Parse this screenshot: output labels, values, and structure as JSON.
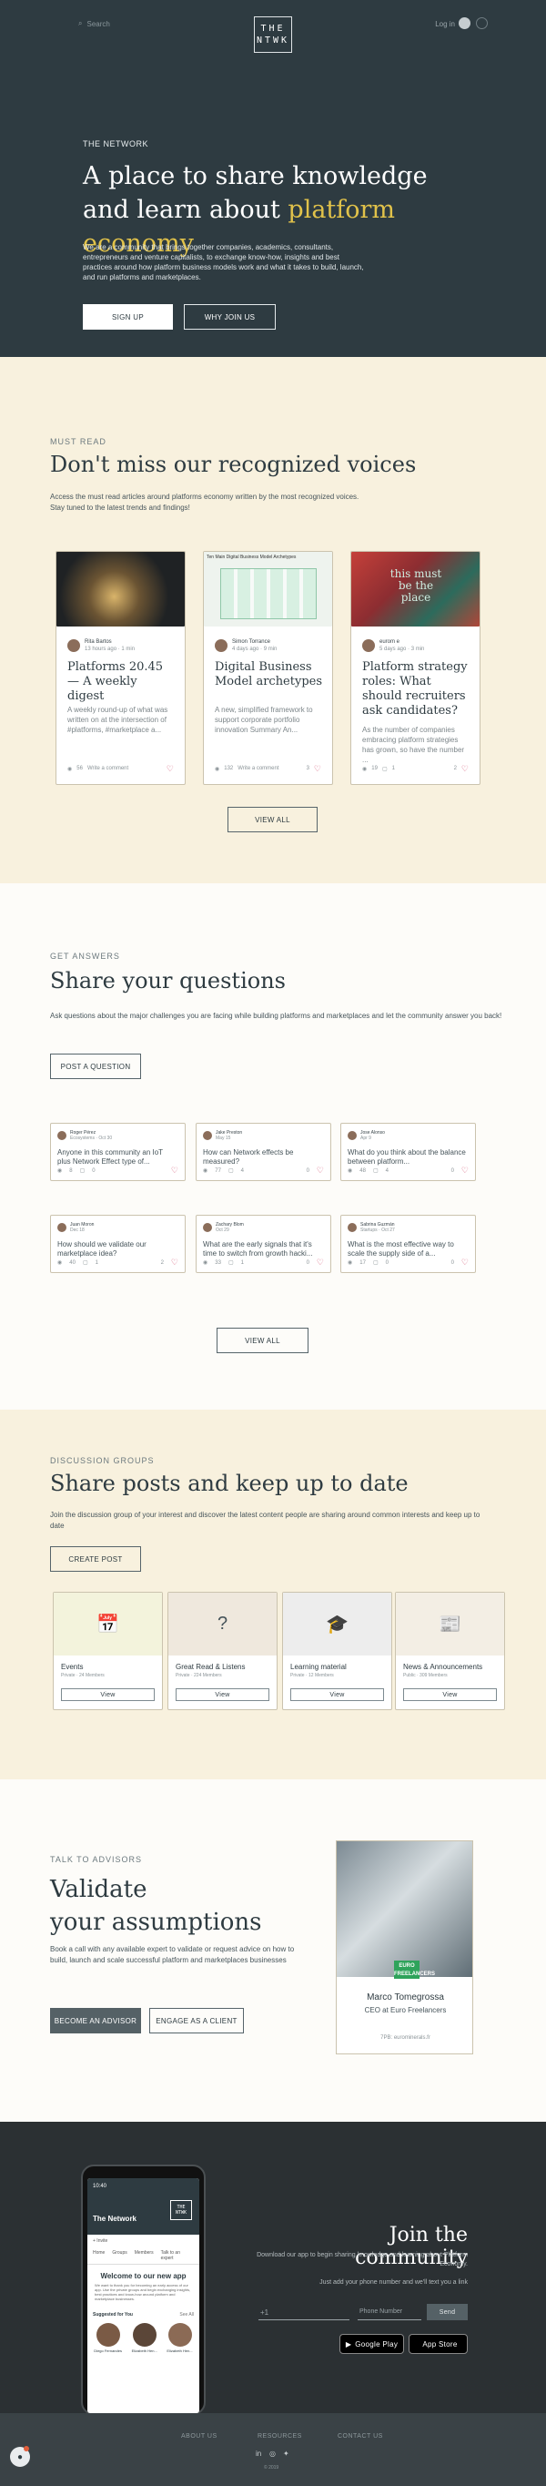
{
  "topbar": {
    "search_placeholder": "Search",
    "logo_line1": "THE",
    "logo_line2": "NTWK",
    "login": "Log in"
  },
  "hero": {
    "eyebrow": "THE NETWORK",
    "title_line1": "A place to share knowledge",
    "title_line2_prefix": "and learn about ",
    "title_highlight": "platform economy",
    "description": "We are a community that brings together companies, academics, consultants, entrepreneurs and venture capitalists, to exchange know-how, insights and best practices around how platform business models work and what it takes to build, launch, and run platforms and marketplaces.",
    "signup": "SIGN UP",
    "why": "WHY JOIN US",
    "colors": {
      "bg": "#2e3b41",
      "highlight": "#e1c24a"
    }
  },
  "must_read": {
    "eyebrow": "MUST READ",
    "title": "Don't miss our recognized voices",
    "description_line1": "Access the must read articles around platforms economy written by the most recognized voices.",
    "description_line2": "Stay tuned to the latest trends and findings!",
    "view_all": "VIEW ALL",
    "articles": [
      {
        "author": "Rita Bartos",
        "time": "13 hours ago · 1 min",
        "title": "Platforms 20.45 — A weekly digest",
        "excerpt": "A weekly round-up of what was written on at the intersection of #platforms, #marketplace a...",
        "views": "56",
        "comment_label": "Write a comment",
        "likes": ""
      },
      {
        "author": "Simon Torrance",
        "time": "4 days ago · 9 min",
        "title": "Digital Business Model archetypes",
        "excerpt": "A new, simplified framework to support corporate portfolio innovation Summary An...",
        "image_text": "Ten Main Digital Business Model Archetypes",
        "views": "132",
        "comment_label": "Write a comment",
        "likes": "3"
      },
      {
        "author": "eurom e",
        "time": "5 days ago · 3 min",
        "title": "Platform strategy roles: What should recruiters ask candidates?",
        "excerpt": "As the number of companies embracing platform strategies has grown, so have the number ...",
        "image_text": "this must be the place",
        "views": "19",
        "comments": "1",
        "likes": "2"
      }
    ]
  },
  "questions": {
    "eyebrow": "GET ANSWERS",
    "title": "Share your questions",
    "description": "Ask questions about the major challenges you are facing while building platforms and marketplaces and let the community answer you back!",
    "post_button": "POST A QUESTION",
    "view_all": "VIEW ALL",
    "items": [
      {
        "name": "Roger Pérez",
        "time": "Ecosystems · Oct 30",
        "question": "Anyone in this community an IoT plus Network Effect type of...",
        "views": "8",
        "answers": "0",
        "likes": ""
      },
      {
        "name": "Jake Preston",
        "time": "May 15",
        "question": "How can Network effects be measured?",
        "views": "77",
        "answers": "4",
        "likes": "0"
      },
      {
        "name": "Jose Alonso",
        "time": "Apr 9",
        "question": "What do you think about the balance between platform...",
        "views": "48",
        "answers": "4",
        "likes": "0"
      },
      {
        "name": "Juan Moron",
        "time": "Dec 18",
        "question": "How should we validate our marketplace idea?",
        "views": "40",
        "answers": "1",
        "likes": "2"
      },
      {
        "name": "Zachary Blom",
        "time": "Oct 29",
        "question": "What are the early signals that it's time to switch from growth hacki...",
        "views": "33",
        "answers": "1",
        "likes": "0"
      },
      {
        "name": "Sabrina Guzmán",
        "time": "Startups · Oct 27",
        "question": "What is the most effective way to scale the supply side of a...",
        "views": "17",
        "answers": "0",
        "likes": "0"
      }
    ]
  },
  "groups": {
    "eyebrow": "DISCUSSION GROUPS",
    "title": "Share posts and keep up to date",
    "description": "Join the discussion group of your interest and discover the latest content people are sharing around common interests and keep up to date",
    "create_button": "CREATE POST",
    "items": [
      {
        "name": "Events",
        "sub": "Private · 24 Members",
        "view": "View",
        "icon": "calendar-icon"
      },
      {
        "name": "Great Read & Listens",
        "sub": "Private · 224 Members",
        "view": "View",
        "icon": "chat-question-icon"
      },
      {
        "name": "Learning material",
        "sub": "Private · 12 Members",
        "view": "View",
        "icon": "graduation-cap-icon"
      },
      {
        "name": "News & Announcements",
        "sub": "Public · 309 Members",
        "view": "View",
        "icon": "newspaper-icon"
      }
    ]
  },
  "advisors": {
    "eyebrow": "TALK TO ADVISORS",
    "title_line1": "Validate",
    "title_line2": "your assumptions",
    "description": "Book a call with any available expert to validate or request advice on how to build, launch and scale successful platform and marketplaces businesses",
    "become": "BECOME AN ADVISOR",
    "engage": "ENGAGE AS A CLIENT",
    "badge": "EURO FREELANCERS",
    "person_name": "Marco Tomegrossa",
    "person_role": "CEO at Euro Freelancers",
    "person_web": "7PB: eurominerals.fr"
  },
  "community": {
    "title": "Join the community",
    "description": "Download our app to begin sharing knowledge and learning about Platform Economy.",
    "sub": "Just add your phone number and we'll text you a link",
    "prefix": "+1",
    "phone_placeholder": "Phone Number",
    "send": "Send",
    "google_play": "Google Play",
    "app_store": "App Store",
    "phone": {
      "time": "10:40",
      "app_title": "The Network",
      "invite": "+ Invite",
      "tabs": [
        "Home",
        "Groups",
        "Members",
        "Talk to an expert"
      ],
      "welcome": "Welcome to our new app",
      "welcome_text": "We want to thank you for becoming an early access of our app. Use the private groups and begin exchanging insights, best practices and know-how around platform and marketplace businesses.",
      "suggested": "Suggested for You",
      "see_all": "See All",
      "people": [
        "Diego Fernandes",
        "Elizabeth Hen...",
        "Elizabeth Hen..."
      ]
    }
  },
  "footer": {
    "links": [
      "ABOUT US",
      "RESOURCES",
      "CONTACT US"
    ],
    "copyright": "© 2019"
  }
}
